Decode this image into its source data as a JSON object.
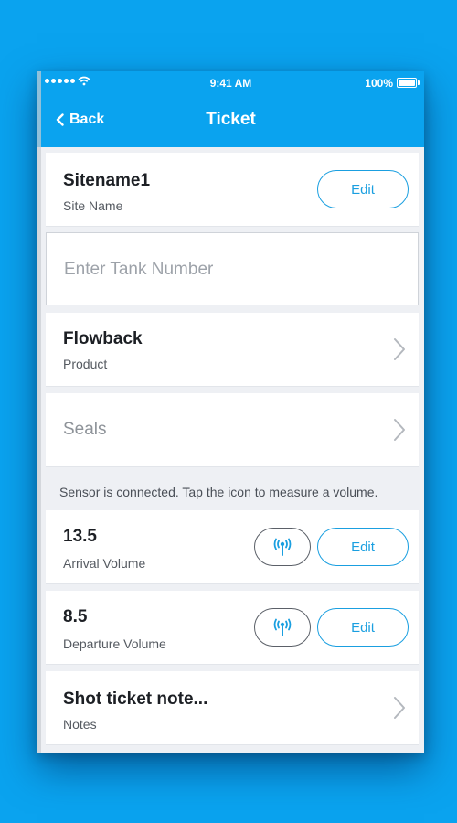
{
  "status_bar": {
    "time": "9:41 AM",
    "battery": "100%"
  },
  "navbar": {
    "back_label": "Back",
    "title": "Ticket"
  },
  "site": {
    "value": "Sitename1",
    "label": "Site Name",
    "edit_label": "Edit"
  },
  "tank": {
    "placeholder": "Enter Tank Number"
  },
  "product": {
    "value": "Flowback",
    "label": "Product"
  },
  "seals": {
    "label": "Seals"
  },
  "sensor_hint": "Sensor is connected. Tap the icon to measure a volume.",
  "arrival": {
    "value": "13.5",
    "label": "Arrival Volume",
    "edit_label": "Edit"
  },
  "departure": {
    "value": "8.5",
    "label": "Departure Volume",
    "edit_label": "Edit"
  },
  "notes": {
    "value": "Shot ticket note...",
    "label": "Notes"
  },
  "colors": {
    "accent": "#0aa3ef",
    "button_border": "#1a9fe0",
    "sensor_icon": "#1a9fe0"
  },
  "icons": [
    "signal-dots-icon",
    "wifi-icon",
    "battery-icon",
    "chevron-left-icon",
    "chevron-right-icon",
    "antenna-icon"
  ]
}
